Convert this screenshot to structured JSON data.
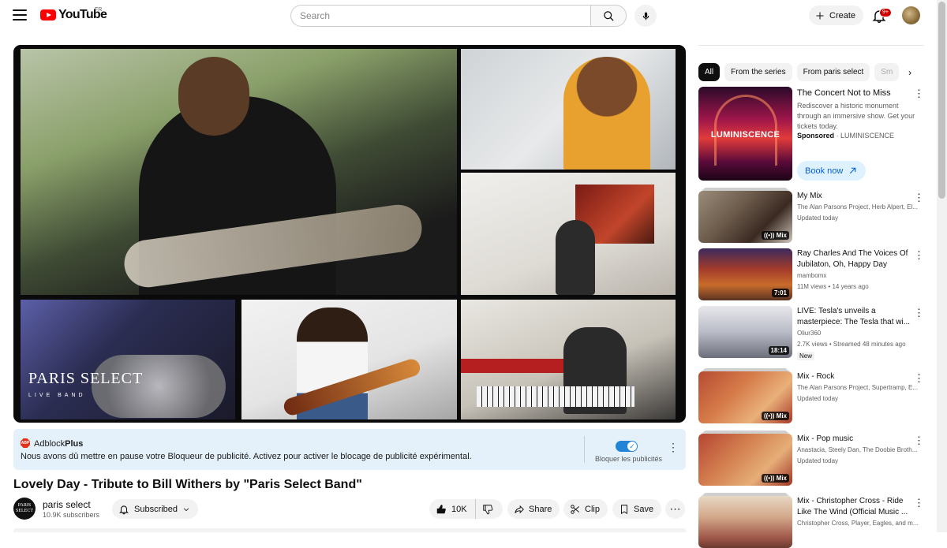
{
  "header": {
    "logo_text": "YouTube",
    "region": "FR",
    "search_placeholder": "Search",
    "create_label": "Create",
    "notif_count": "9+"
  },
  "player": {
    "overlay_brand": "PARIS SELECT",
    "overlay_sub": "LIVE BAND"
  },
  "adblock": {
    "logo_abbr": "ABP",
    "brand_plain": "Adblock",
    "brand_bold": "Plus",
    "message": "Nous avons dû mettre en pause votre Bloqueur de publicité. Activez pour activer le blocage de publicité expérimental.",
    "toggle_label": "Bloquer les publicités",
    "toggle_on": true
  },
  "video": {
    "title": "Lovely Day - Tribute to Bill Withers by \"Paris Select Band\"",
    "channel_name": "paris select",
    "channel_avatar_text": "PARIS SELECT",
    "subscribers": "10.9K subscribers",
    "subscribed_label": "Subscribed",
    "likes": "10K",
    "share_label": "Share",
    "clip_label": "Clip",
    "save_label": "Save"
  },
  "sidebar": {
    "chips": [
      {
        "label": "All",
        "active": true
      },
      {
        "label": "From the series",
        "active": false
      },
      {
        "label": "From paris select",
        "active": false
      },
      {
        "label": "Sm",
        "active": false
      }
    ],
    "ad": {
      "thumb_text": "LUMINISCENCE",
      "title": "The Concert Not to Miss",
      "description": "Rediscover a historic monument through an immersive show. Get your tickets today.",
      "sponsored": "Sponsored",
      "advertiser": "LUMINISCENCE",
      "cta": "Book now"
    },
    "items": [
      {
        "title": "My Mix",
        "line1": "The Alan Parsons Project, Herb Alpert, El...",
        "line2": "Updated today",
        "badge": "Mix",
        "new": ""
      },
      {
        "title": "Ray Charles And The Voices Of Jubilaton,  Oh, Happy Day",
        "line1": "mambomx",
        "line2": "11M views • 14 years ago",
        "badge": "7:01",
        "new": ""
      },
      {
        "title": "LIVE: Tesla's unveils a masterpiece: The Tesla that wi...",
        "line1": "Oliur360",
        "line2": "2.7K views • Streamed 48 minutes ago",
        "badge": "18:14",
        "new": "New"
      },
      {
        "title": "Mix - Rock",
        "line1": "The Alan Parsons Project, Supertramp, E...",
        "line2": "Updated today",
        "badge": "Mix",
        "new": ""
      },
      {
        "title": "Mix - Pop music",
        "line1": "Anastacia, Steely Dan, The Doobie Broth...",
        "line2": "Updated today",
        "badge": "Mix",
        "new": ""
      },
      {
        "title": "Mix - Christopher Cross - Ride Like The Wind (Official Music ...",
        "line1": "Christopher Cross, Player, Eagles, and m...",
        "line2": "",
        "badge": "",
        "new": ""
      }
    ]
  }
}
